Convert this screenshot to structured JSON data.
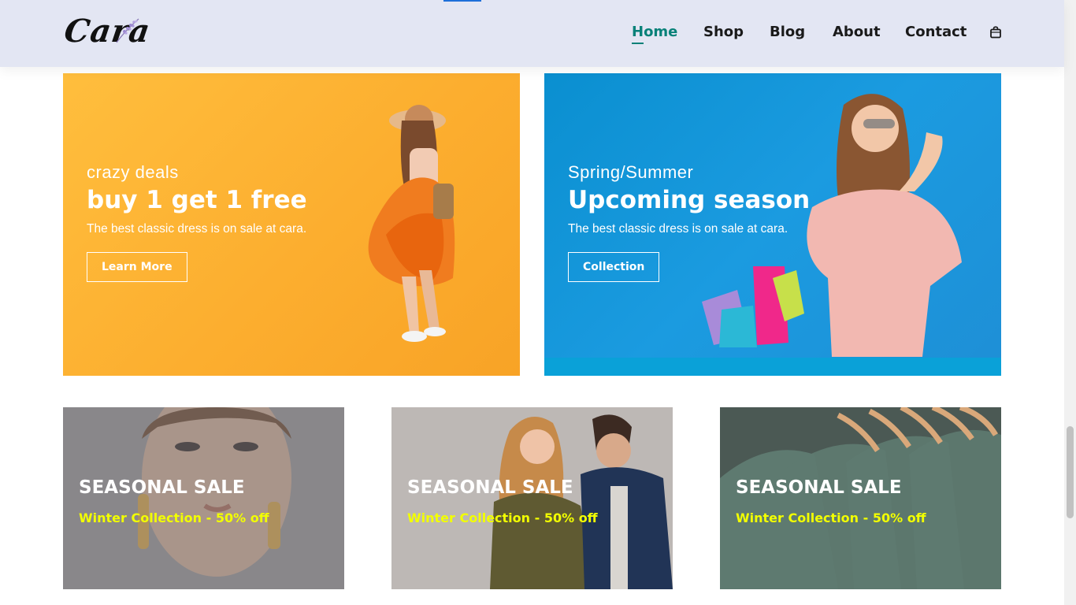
{
  "brand": {
    "logo_text": "Cara"
  },
  "nav": {
    "items": [
      {
        "label": "Home",
        "active": true
      },
      {
        "label": "Shop"
      },
      {
        "label": "Blog"
      },
      {
        "label": "About"
      },
      {
        "label": "Contact"
      }
    ],
    "cart_icon": "shopping-bag-icon"
  },
  "banners": [
    {
      "eyebrow": "crazy deals",
      "title": "buy 1 get 1 free",
      "subtitle": "The best classic dress is on sale at cara.",
      "button_label": "Learn More"
    },
    {
      "eyebrow": "Spring/Summer",
      "title": "Upcoming season",
      "subtitle": "The best classic dress is on sale at cara.",
      "button_label": "Collection"
    }
  ],
  "seasonal": [
    {
      "title": "SEASONAL SALE",
      "subtitle": "Winter Collection - 50% off"
    },
    {
      "title": "SEASONAL SALE",
      "subtitle": "Winter Collection - 50% off"
    },
    {
      "title": "SEASONAL SALE",
      "subtitle": "Winter Collection - 50% off"
    }
  ],
  "colors": {
    "header_bg": "#e3e6f3",
    "accent": "#088178",
    "banner1_bg": "#fcae2f",
    "banner2_bg": "#1b9be0",
    "sale_highlight": "#f2ff00"
  }
}
